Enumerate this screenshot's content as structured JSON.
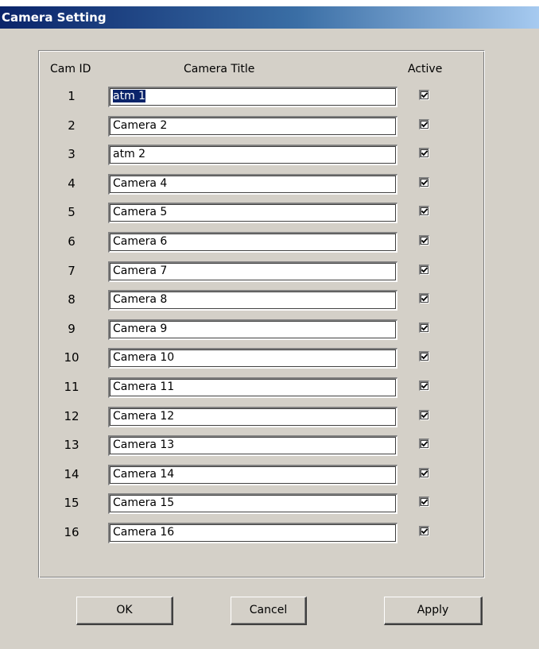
{
  "window": {
    "title": "Camera Setting"
  },
  "headers": {
    "cam_id": "Cam ID",
    "camera_title": "Camera Title",
    "active": "Active"
  },
  "cameras": [
    {
      "id": "1",
      "title": "atm 1",
      "active": true,
      "selected": true
    },
    {
      "id": "2",
      "title": "Camera 2",
      "active": true
    },
    {
      "id": "3",
      "title": "atm 2",
      "active": true
    },
    {
      "id": "4",
      "title": "Camera 4",
      "active": true
    },
    {
      "id": "5",
      "title": "Camera 5",
      "active": true
    },
    {
      "id": "6",
      "title": "Camera 6",
      "active": true
    },
    {
      "id": "7",
      "title": "Camera 7",
      "active": true
    },
    {
      "id": "8",
      "title": "Camera 8",
      "active": true
    },
    {
      "id": "9",
      "title": "Camera 9",
      "active": true
    },
    {
      "id": "10",
      "title": "Camera 10",
      "active": true
    },
    {
      "id": "11",
      "title": "Camera 11",
      "active": true
    },
    {
      "id": "12",
      "title": "Camera 12",
      "active": true
    },
    {
      "id": "13",
      "title": "Camera 13",
      "active": true
    },
    {
      "id": "14",
      "title": "Camera 14",
      "active": true
    },
    {
      "id": "15",
      "title": "Camera 15",
      "active": true
    },
    {
      "id": "16",
      "title": "Camera 16",
      "active": true
    }
  ],
  "buttons": {
    "ok": "OK",
    "cancel": "Cancel",
    "apply": "Apply"
  },
  "colors": {
    "dialog_face": "#d4d0c8",
    "titlebar_start": "#0a246a",
    "selection": "#0a246a"
  },
  "icons": {
    "check": "checkmark-icon"
  }
}
